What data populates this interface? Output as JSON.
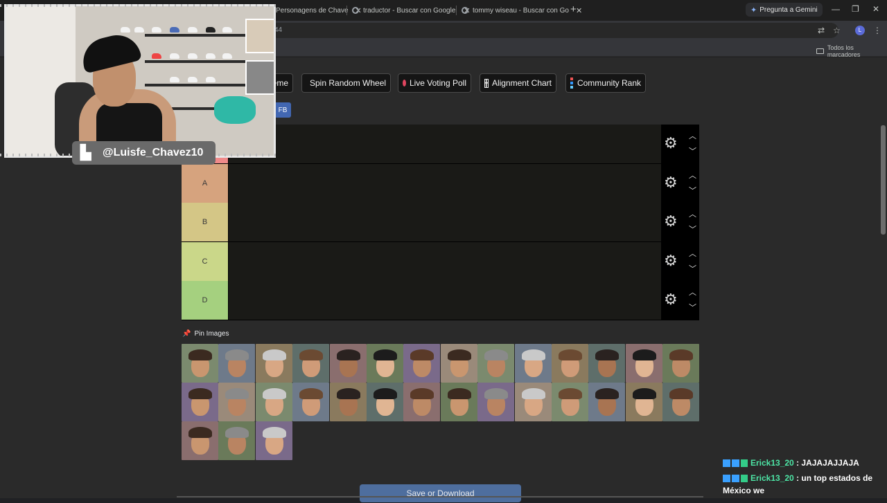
{
  "browser": {
    "tabs": [
      {
        "label": "Personagens de Chave"
      },
      {
        "label": "traductor - Buscar con Google"
      },
      {
        "label": "tommy wiseau - Buscar con Go"
      }
    ],
    "gemini_label": "Pregunta a Gemini",
    "url_fragment": "44",
    "bookmarks_label": "Todos los marcadores",
    "profile_initial": "L"
  },
  "toolbar_buttons": [
    {
      "label": "eme",
      "icon": "theme-icon"
    },
    {
      "label": "Spin Random Wheel",
      "icon": "wheel-icon"
    },
    {
      "label": "Live Voting Poll",
      "icon": "red-dot-icon"
    },
    {
      "label": "Alignment Chart",
      "icon": "grid-icon"
    },
    {
      "label": "Community Rank",
      "icon": "color-grid-icon"
    }
  ],
  "share": {
    "fb_label": "FB"
  },
  "tiers": [
    {
      "label": "",
      "color": "#f08a8a"
    },
    {
      "label": "A",
      "color": "#d6a37e"
    },
    {
      "label": "B",
      "color": "#d4c686"
    },
    {
      "label": "C",
      "color": "#cad789"
    },
    {
      "label": "D",
      "color": "#a5d07f"
    }
  ],
  "pin_images": {
    "title": "Pin Images",
    "count": 31
  },
  "save": {
    "label": "Save or Download"
  },
  "overlay": {
    "handle": "@Luisfe_Chavez10"
  },
  "chat": [
    {
      "user": "Erick13_20",
      "message": "JAJAJAJJAJA"
    },
    {
      "user": "Erick13_20",
      "message": "un top estados de México we"
    }
  ],
  "colors": {
    "accent_blue": "#4e6e9e",
    "fb_blue": "#4267b2",
    "chat_user": "#4de6a6"
  }
}
